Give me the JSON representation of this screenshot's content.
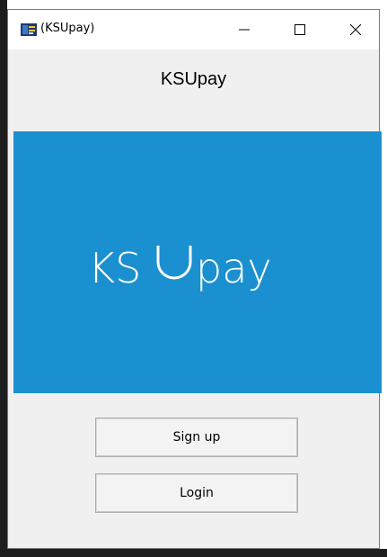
{
  "window": {
    "title": "(KSUpay)",
    "controls": {
      "minimize_icon": "minimize-icon",
      "maximize_icon": "maximize-icon",
      "close_icon": "close-icon"
    }
  },
  "main": {
    "heading": "KSUpay",
    "banner": {
      "logo_text_left": "KS",
      "logo_text_right": "pay",
      "background_color": "#1a90d0",
      "logo_color": "#ffffff"
    },
    "buttons": {
      "signup_label": "Sign up",
      "login_label": "Login"
    }
  }
}
